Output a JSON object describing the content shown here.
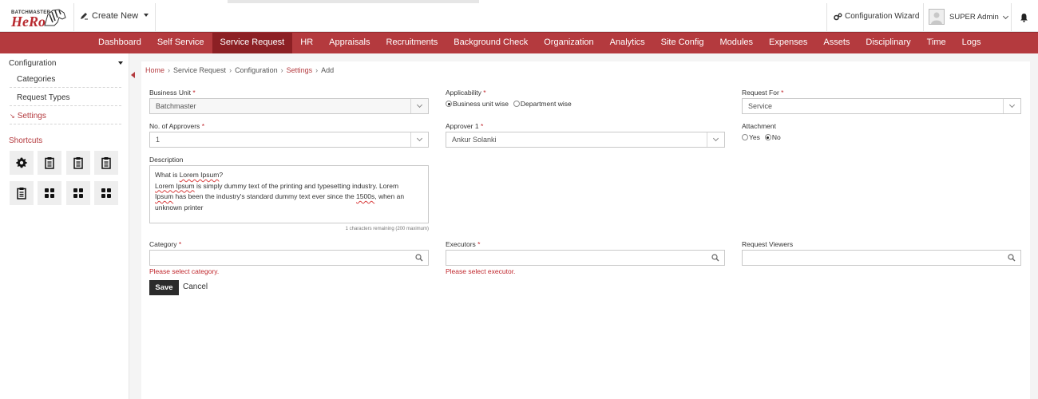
{
  "header": {
    "logo_brand": "BATCHMASTER",
    "logo_text": "HeRo",
    "create_new_label": "Create New",
    "config_wizard_label": "Configuration Wizard",
    "user_name": "SUPER Admin"
  },
  "nav": {
    "items": [
      "Dashboard",
      "Self Service",
      "Service Request",
      "HR",
      "Appraisals",
      "Recruitments",
      "Background Check",
      "Organization",
      "Analytics",
      "Site Config",
      "Modules",
      "Expenses",
      "Assets",
      "Disciplinary",
      "Time",
      "Logs"
    ],
    "active": "Service Request"
  },
  "sidebar": {
    "section_title": "Configuration",
    "items": [
      "Categories",
      "Request Types",
      "Settings"
    ],
    "selected": "Settings",
    "shortcuts_label": "Shortcuts",
    "shortcut_icons": [
      "gear-icon",
      "clipboard-icon",
      "clipboard-icon",
      "clipboard-icon",
      "clipboard-icon",
      "grid-icon",
      "grid-icon",
      "grid-icon"
    ]
  },
  "breadcrumb": [
    "Home",
    "Service Request",
    "Configuration",
    "Settings",
    "Add"
  ],
  "form": {
    "business_unit": {
      "label": "Business Unit",
      "value": "Batchmaster"
    },
    "applicability": {
      "label": "Applicability",
      "options": [
        "Business unit wise",
        "Department wise"
      ],
      "selected": "Business unit wise"
    },
    "request_for": {
      "label": "Request For",
      "value": "Service"
    },
    "approvers": {
      "label": "No. of Approvers",
      "value": "1"
    },
    "approver1": {
      "label": "Approver 1",
      "value": "Ankur Solanki"
    },
    "attachment": {
      "label": "Attachment",
      "options": [
        "Yes",
        "No"
      ],
      "selected": "No"
    },
    "description": {
      "label": "Description",
      "line1": "What is Lorem Ipsum?",
      "line2": "Lorem Ipsum is simply dummy text of the printing and typesetting industry. Lorem",
      "line3": "Ipsum has been the industry's standard dummy text ever since the 1500s, when an",
      "line4": "unknown printer",
      "hint": "1 characters remaining (200 maximum)"
    },
    "category": {
      "label": "Category",
      "value": "",
      "error": "Please select category."
    },
    "executors": {
      "label": "Executors",
      "value": "",
      "error": "Please select executor."
    },
    "viewers": {
      "label": "Request Viewers",
      "value": ""
    },
    "required_mark": "*",
    "save_label": "Save",
    "cancel_label": "Cancel"
  },
  "colors": {
    "brand_red": "#b43a3e",
    "active_nav": "#8c2024",
    "save_button": "#2b2b2b",
    "error": "#c0262c"
  }
}
